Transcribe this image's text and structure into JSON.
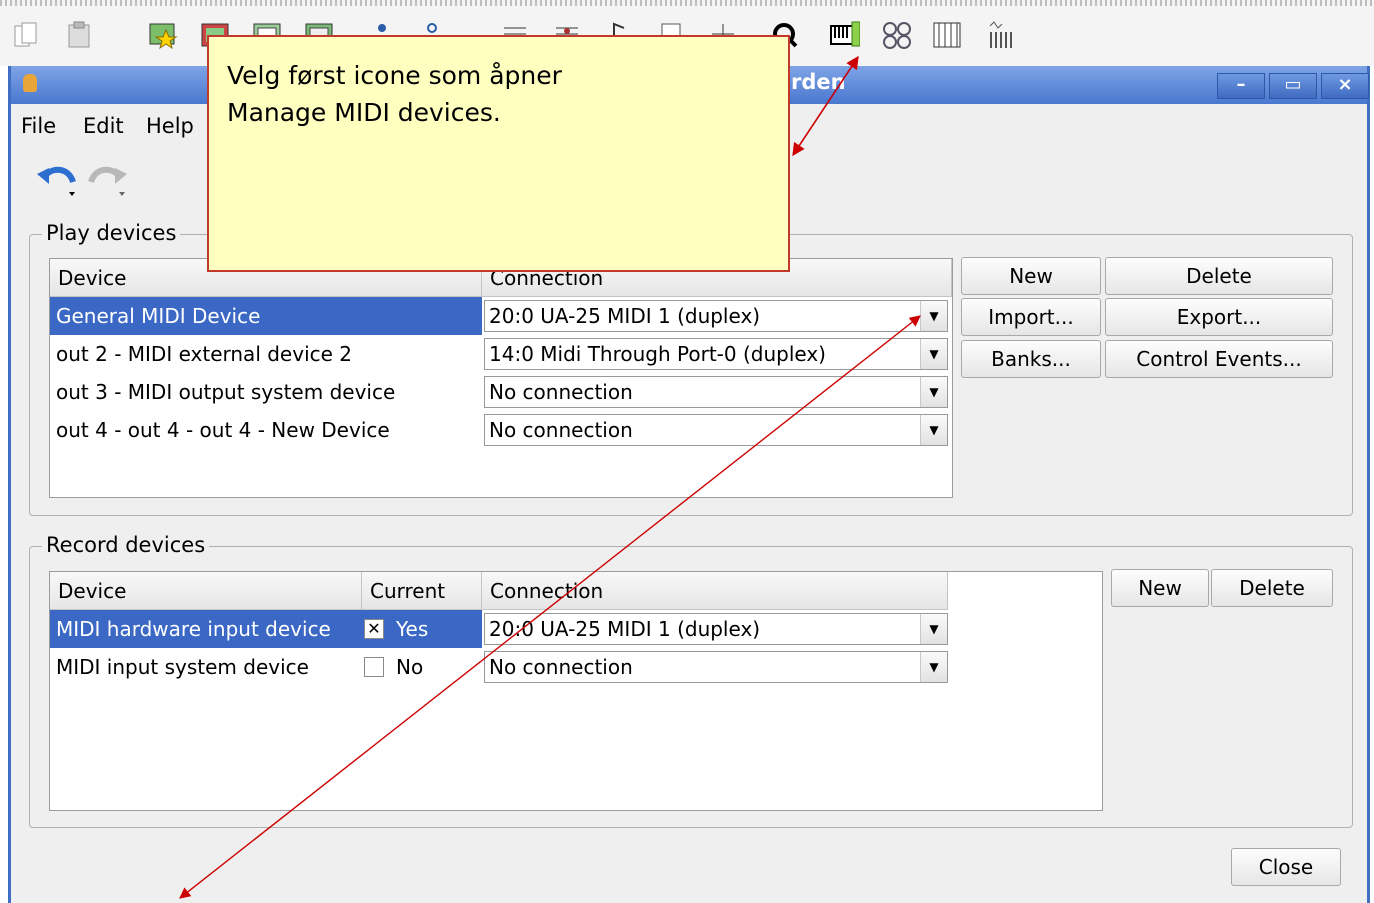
{
  "window": {
    "title_fragment": "rden"
  },
  "menu": {
    "file": "File",
    "edit": "Edit",
    "help": "Help"
  },
  "callout": {
    "line1": "Velg først icone som åpner",
    "line2": "Manage MIDI devices."
  },
  "play_devices": {
    "title": "Play devices",
    "headers": [
      "Device",
      "Connection"
    ],
    "rows": [
      {
        "device": "General MIDI Device",
        "connection": "20:0 UA-25 MIDI 1 (duplex)"
      },
      {
        "device": "out 2 - MIDI external device 2",
        "connection": "14:0 Midi Through Port-0 (duplex)"
      },
      {
        "device": "out 3 - MIDI output system device",
        "connection": "No connection"
      },
      {
        "device": "out 4 - out 4 - out 4 - New Device",
        "connection": "No connection"
      }
    ],
    "buttons": {
      "new": "New",
      "delete": "Delete",
      "import": "Import...",
      "export": "Export...",
      "banks": "Banks...",
      "control_events": "Control Events..."
    }
  },
  "record_devices": {
    "title": "Record devices",
    "headers": [
      "Device",
      "Current",
      "Connection"
    ],
    "rows": [
      {
        "device": "MIDI hardware input device",
        "current": "Yes",
        "connection": "20:0 UA-25 MIDI 1 (duplex)"
      },
      {
        "device": "MIDI input system device",
        "current": "No",
        "connection": "No connection"
      }
    ],
    "buttons": {
      "new": "New",
      "delete": "Delete"
    }
  },
  "close_button": "Close",
  "colors": {
    "selection": "#3b68c5",
    "titlebar": "#4a78cf",
    "callout_bg": "#ffffc0",
    "arrow": "#cc0000"
  }
}
